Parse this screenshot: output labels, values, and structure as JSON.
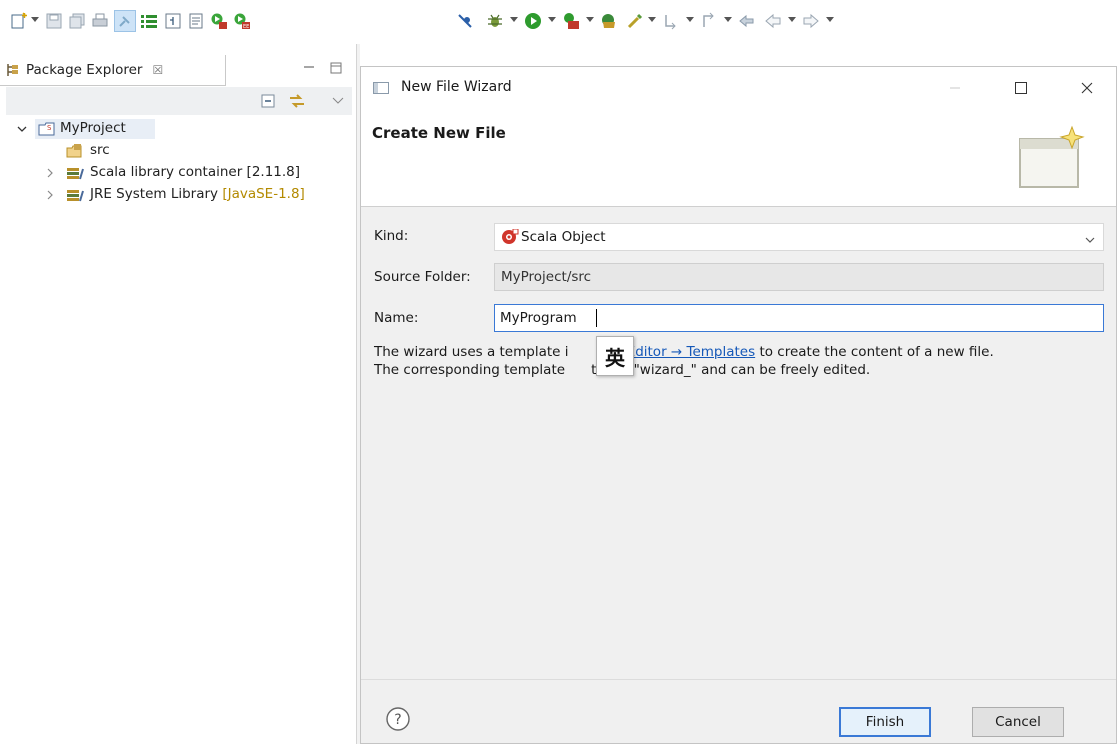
{
  "toolbar": {
    "left_icons": [
      "new-icon",
      "save-icon",
      "save-all-icon",
      "print-icon",
      "toggle-mark-occurrences-icon",
      "task-list-icon",
      "scala-worksheet-icon",
      "file-icon",
      "run-scala-icon",
      "scala-interpreter-icon"
    ],
    "right_icons": [
      "skip-breakpoints-icon",
      "debug-icon",
      "run-icon",
      "coverage-icon",
      "external-tools-icon",
      "search-icon",
      "next-annotation-icon",
      "previous-annotation-icon",
      "last-edit-icon",
      "back-icon",
      "forward-icon"
    ]
  },
  "explorer": {
    "tab_label": "Package Explorer",
    "tree": [
      {
        "label": "MyProject",
        "level": 0,
        "expanded": true,
        "selected": true
      },
      {
        "label": "src",
        "level": 1
      },
      {
        "label": "Scala library container [2.11.8]",
        "level": 1,
        "collapsed": true
      },
      {
        "label": "JRE System Library",
        "decoration": "[JavaSE-1.8]",
        "level": 1,
        "collapsed": true
      }
    ]
  },
  "dialog": {
    "window_title": "New File Wizard",
    "header_title": "Create New File",
    "fields": {
      "kind_label": "Kind:",
      "kind_value": "Scala Object",
      "source_folder_label": "Source Folder:",
      "source_folder_value": "MyProject/src",
      "name_label": "Name:",
      "name_value": "MyProgram"
    },
    "description": {
      "line1_before": "The wizard uses a template i",
      "line1_link": "a → Editor → Templates",
      "line1_after": " to create the content of a new file.",
      "line2_before": "The corresponding template",
      "line2_after": "t with \"wizard_\" and can be freely edited."
    },
    "ime_indicator": "英",
    "buttons": {
      "finish": "Finish",
      "cancel": "Cancel"
    }
  }
}
